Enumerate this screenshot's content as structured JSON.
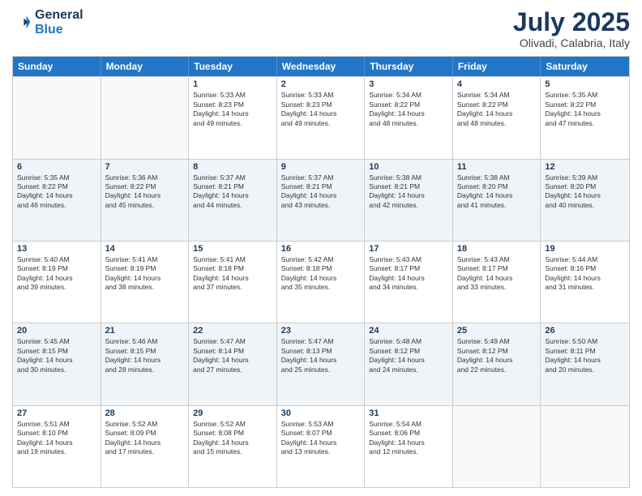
{
  "header": {
    "logo_line1": "General",
    "logo_line2": "Blue",
    "month": "July 2025",
    "location": "Olivadi, Calabria, Italy"
  },
  "weekdays": [
    "Sunday",
    "Monday",
    "Tuesday",
    "Wednesday",
    "Thursday",
    "Friday",
    "Saturday"
  ],
  "rows": [
    [
      {
        "day": "",
        "info": ""
      },
      {
        "day": "",
        "info": ""
      },
      {
        "day": "1",
        "info": "Sunrise: 5:33 AM\nSunset: 8:23 PM\nDaylight: 14 hours\nand 49 minutes."
      },
      {
        "day": "2",
        "info": "Sunrise: 5:33 AM\nSunset: 8:23 PM\nDaylight: 14 hours\nand 49 minutes."
      },
      {
        "day": "3",
        "info": "Sunrise: 5:34 AM\nSunset: 8:22 PM\nDaylight: 14 hours\nand 48 minutes."
      },
      {
        "day": "4",
        "info": "Sunrise: 5:34 AM\nSunset: 8:22 PM\nDaylight: 14 hours\nand 48 minutes."
      },
      {
        "day": "5",
        "info": "Sunrise: 5:35 AM\nSunset: 8:22 PM\nDaylight: 14 hours\nand 47 minutes."
      }
    ],
    [
      {
        "day": "6",
        "info": "Sunrise: 5:35 AM\nSunset: 8:22 PM\nDaylight: 14 hours\nand 46 minutes."
      },
      {
        "day": "7",
        "info": "Sunrise: 5:36 AM\nSunset: 8:22 PM\nDaylight: 14 hours\nand 45 minutes."
      },
      {
        "day": "8",
        "info": "Sunrise: 5:37 AM\nSunset: 8:21 PM\nDaylight: 14 hours\nand 44 minutes."
      },
      {
        "day": "9",
        "info": "Sunrise: 5:37 AM\nSunset: 8:21 PM\nDaylight: 14 hours\nand 43 minutes."
      },
      {
        "day": "10",
        "info": "Sunrise: 5:38 AM\nSunset: 8:21 PM\nDaylight: 14 hours\nand 42 minutes."
      },
      {
        "day": "11",
        "info": "Sunrise: 5:38 AM\nSunset: 8:20 PM\nDaylight: 14 hours\nand 41 minutes."
      },
      {
        "day": "12",
        "info": "Sunrise: 5:39 AM\nSunset: 8:20 PM\nDaylight: 14 hours\nand 40 minutes."
      }
    ],
    [
      {
        "day": "13",
        "info": "Sunrise: 5:40 AM\nSunset: 8:19 PM\nDaylight: 14 hours\nand 39 minutes."
      },
      {
        "day": "14",
        "info": "Sunrise: 5:41 AM\nSunset: 8:19 PM\nDaylight: 14 hours\nand 38 minutes."
      },
      {
        "day": "15",
        "info": "Sunrise: 5:41 AM\nSunset: 8:18 PM\nDaylight: 14 hours\nand 37 minutes."
      },
      {
        "day": "16",
        "info": "Sunrise: 5:42 AM\nSunset: 8:18 PM\nDaylight: 14 hours\nand 35 minutes."
      },
      {
        "day": "17",
        "info": "Sunrise: 5:43 AM\nSunset: 8:17 PM\nDaylight: 14 hours\nand 34 minutes."
      },
      {
        "day": "18",
        "info": "Sunrise: 5:43 AM\nSunset: 8:17 PM\nDaylight: 14 hours\nand 33 minutes."
      },
      {
        "day": "19",
        "info": "Sunrise: 5:44 AM\nSunset: 8:16 PM\nDaylight: 14 hours\nand 31 minutes."
      }
    ],
    [
      {
        "day": "20",
        "info": "Sunrise: 5:45 AM\nSunset: 8:15 PM\nDaylight: 14 hours\nand 30 minutes."
      },
      {
        "day": "21",
        "info": "Sunrise: 5:46 AM\nSunset: 8:15 PM\nDaylight: 14 hours\nand 28 minutes."
      },
      {
        "day": "22",
        "info": "Sunrise: 5:47 AM\nSunset: 8:14 PM\nDaylight: 14 hours\nand 27 minutes."
      },
      {
        "day": "23",
        "info": "Sunrise: 5:47 AM\nSunset: 8:13 PM\nDaylight: 14 hours\nand 25 minutes."
      },
      {
        "day": "24",
        "info": "Sunrise: 5:48 AM\nSunset: 8:12 PM\nDaylight: 14 hours\nand 24 minutes."
      },
      {
        "day": "25",
        "info": "Sunrise: 5:49 AM\nSunset: 8:12 PM\nDaylight: 14 hours\nand 22 minutes."
      },
      {
        "day": "26",
        "info": "Sunrise: 5:50 AM\nSunset: 8:11 PM\nDaylight: 14 hours\nand 20 minutes."
      }
    ],
    [
      {
        "day": "27",
        "info": "Sunrise: 5:51 AM\nSunset: 8:10 PM\nDaylight: 14 hours\nand 19 minutes."
      },
      {
        "day": "28",
        "info": "Sunrise: 5:52 AM\nSunset: 8:09 PM\nDaylight: 14 hours\nand 17 minutes."
      },
      {
        "day": "29",
        "info": "Sunrise: 5:52 AM\nSunset: 8:08 PM\nDaylight: 14 hours\nand 15 minutes."
      },
      {
        "day": "30",
        "info": "Sunrise: 5:53 AM\nSunset: 8:07 PM\nDaylight: 14 hours\nand 13 minutes."
      },
      {
        "day": "31",
        "info": "Sunrise: 5:54 AM\nSunset: 8:06 PM\nDaylight: 14 hours\nand 12 minutes."
      },
      {
        "day": "",
        "info": ""
      },
      {
        "day": "",
        "info": ""
      }
    ]
  ]
}
